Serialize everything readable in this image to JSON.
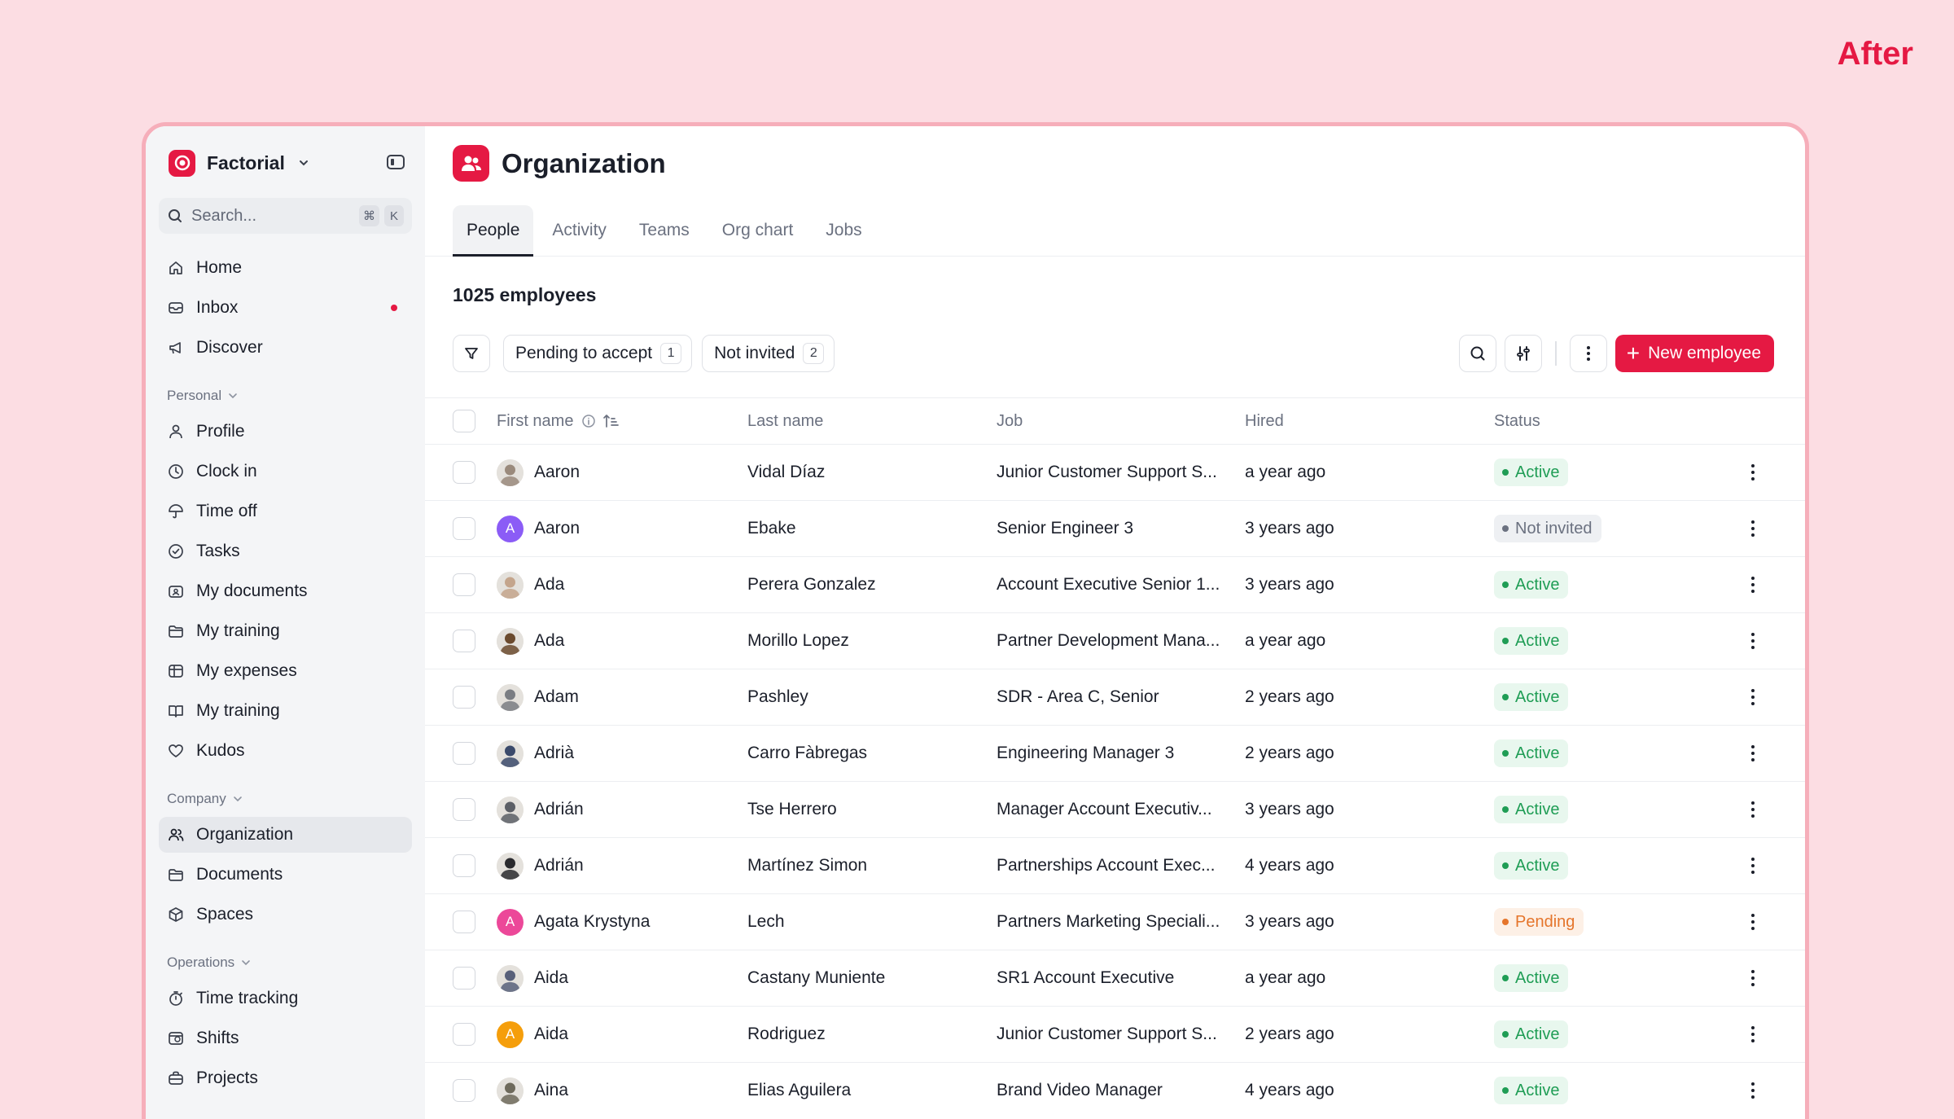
{
  "corner_label": "After",
  "colors": {
    "background": "#fcdde3",
    "brand": "#e51943",
    "active_badge_bg": "#e8f7ee",
    "active_text": "#1f9d55",
    "pending_badge_bg": "#fdf0e6",
    "pending_text": "#e5752b",
    "notinvited_badge_bg": "#eef0f3",
    "notinvited_text": "#6b7180"
  },
  "sidebar": {
    "company_name": "Factorial",
    "search": {
      "placeholder": "Search...",
      "shortcut_mod": "⌘",
      "shortcut_key": "K"
    },
    "top_items": [
      {
        "label": "Home",
        "icon": "home-icon"
      },
      {
        "label": "Inbox",
        "icon": "inbox-icon",
        "unread": true
      },
      {
        "label": "Discover",
        "icon": "megaphone-icon"
      }
    ],
    "sections": [
      {
        "title": "Personal",
        "items": [
          {
            "label": "Profile",
            "icon": "person-icon"
          },
          {
            "label": "Clock in",
            "icon": "clock-icon"
          },
          {
            "label": "Time off",
            "icon": "umbrella-icon"
          },
          {
            "label": "Tasks",
            "icon": "check-circle-icon"
          },
          {
            "label": "My documents",
            "icon": "folder-user-icon"
          },
          {
            "label": "My training",
            "icon": "folder-icon"
          },
          {
            "label": "My expenses",
            "icon": "receipt-icon"
          },
          {
            "label": "My training",
            "icon": "book-icon"
          },
          {
            "label": "Kudos",
            "icon": "heart-icon"
          }
        ]
      },
      {
        "title": "Company",
        "items": [
          {
            "label": "Organization",
            "icon": "people-icon",
            "active": true
          },
          {
            "label": "Documents",
            "icon": "folder-icon"
          },
          {
            "label": "Spaces",
            "icon": "cube-icon"
          }
        ]
      },
      {
        "title": "Operations",
        "items": [
          {
            "label": "Time tracking",
            "icon": "stopwatch-icon"
          },
          {
            "label": "Shifts",
            "icon": "shifts-icon"
          },
          {
            "label": "Projects",
            "icon": "briefcase-icon"
          }
        ]
      }
    ]
  },
  "header": {
    "title": "Organization",
    "tabs": [
      {
        "label": "People",
        "active": true
      },
      {
        "label": "Activity"
      },
      {
        "label": "Teams"
      },
      {
        "label": "Org chart"
      },
      {
        "label": "Jobs"
      }
    ]
  },
  "employee_count": "1025 employees",
  "filters": [
    {
      "label": "Pending to accept",
      "count": "1"
    },
    {
      "label": "Not invited",
      "count": "2"
    }
  ],
  "new_employee_label": "New employee",
  "table": {
    "columns": [
      "First name",
      "Last name",
      "Job",
      "Hired",
      "Status"
    ],
    "rows": [
      {
        "first": "Aaron",
        "last": "Vidal Díaz",
        "job": "Junior Customer Support S...",
        "hired": "a year ago",
        "status": "Active",
        "status_kind": "active",
        "avatar": {
          "type": "photo",
          "color": "#9a8a7c"
        }
      },
      {
        "first": "Aaron",
        "last": "Ebake",
        "job": "Senior Engineer 3",
        "hired": "3 years ago",
        "status": "Not invited",
        "status_kind": "notinvited",
        "avatar": {
          "type": "initial",
          "initial": "A",
          "color": "#8b5cf6"
        }
      },
      {
        "first": "Ada",
        "last": "Perera Gonzalez",
        "job": "Account Executive Senior 1...",
        "hired": "3 years ago",
        "status": "Active",
        "status_kind": "active",
        "avatar": {
          "type": "photo",
          "color": "#c4a58c"
        }
      },
      {
        "first": "Ada",
        "last": "Morillo Lopez",
        "job": "Partner Development Mana...",
        "hired": "a year ago",
        "status": "Active",
        "status_kind": "active",
        "avatar": {
          "type": "photo",
          "color": "#6b4a2e"
        }
      },
      {
        "first": "Adam",
        "last": "Pashley",
        "job": "SDR - Area C, Senior",
        "hired": "2 years ago",
        "status": "Active",
        "status_kind": "active",
        "avatar": {
          "type": "photo",
          "color": "#7a7d83"
        }
      },
      {
        "first": "Adrià",
        "last": "Carro Fàbregas",
        "job": "Engineering Manager 3",
        "hired": "2 years ago",
        "status": "Active",
        "status_kind": "active",
        "avatar": {
          "type": "photo",
          "color": "#3b4a6b"
        }
      },
      {
        "first": "Adrián",
        "last": "Tse Herrero",
        "job": "Manager Account Executiv...",
        "hired": "3 years ago",
        "status": "Active",
        "status_kind": "active",
        "avatar": {
          "type": "photo",
          "color": "#5c5f66"
        }
      },
      {
        "first": "Adrián",
        "last": "Martínez Simon",
        "job": "Partnerships Account Exec...",
        "hired": "4 years ago",
        "status": "Active",
        "status_kind": "active",
        "avatar": {
          "type": "photo",
          "color": "#2a2a2e"
        }
      },
      {
        "first": "Agata Krystyna",
        "last": "Lech",
        "job": "Partners Marketing Speciali...",
        "hired": "3 years ago",
        "status": "Pending",
        "status_kind": "pending",
        "avatar": {
          "type": "initial",
          "initial": "A",
          "color": "#ec4899"
        }
      },
      {
        "first": "Aida",
        "last": "Castany Muniente",
        "job": "SR1 Account Executive",
        "hired": "a year ago",
        "status": "Active",
        "status_kind": "active",
        "avatar": {
          "type": "photo",
          "color": "#58607a"
        }
      },
      {
        "first": "Aida",
        "last": "Rodriguez",
        "job": "Junior Customer Support S...",
        "hired": "2 years ago",
        "status": "Active",
        "status_kind": "active",
        "avatar": {
          "type": "initial",
          "initial": "A",
          "color": "#f59e0b"
        }
      },
      {
        "first": "Aina",
        "last": "Elias Aguilera",
        "job": "Brand Video Manager",
        "hired": "4 years ago",
        "status": "Active",
        "status_kind": "active",
        "avatar": {
          "type": "photo",
          "color": "#6e6a5c"
        }
      }
    ]
  }
}
